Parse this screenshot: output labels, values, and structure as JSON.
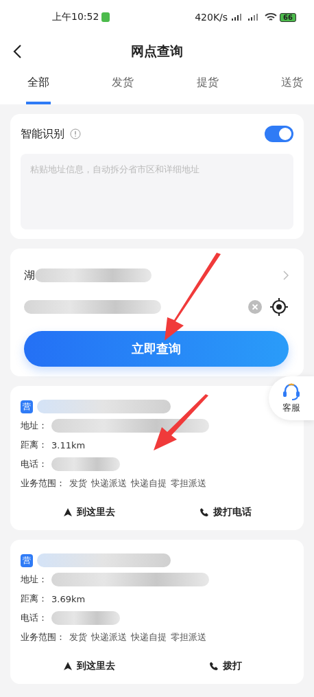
{
  "status_bar": {
    "time": "上午10:52",
    "net_speed": "420K/s",
    "battery": "66"
  },
  "header": {
    "title": "网点查询"
  },
  "tabs": [
    {
      "label": "全部",
      "selected": true
    },
    {
      "label": "发货",
      "selected": false
    },
    {
      "label": "提货",
      "selected": false
    },
    {
      "label": "送货",
      "selected": false
    }
  ],
  "smart_recognition": {
    "label": "智能识别",
    "on": true,
    "placeholder": "粘贴地址信息，自动拆分省市区和详细地址"
  },
  "address": {
    "region": "湖",
    "query_button": "立即查询"
  },
  "service_button": {
    "label": "客服"
  },
  "results": [
    {
      "badge": "营",
      "address_label": "地址：",
      "distance_label": "距离：",
      "distance": "3.11km",
      "phone_label": "电话：",
      "scope_label": "业务范围：",
      "services": [
        "发货",
        "快递派送",
        "快递自提",
        "零担派送"
      ],
      "actions": [
        "到这里去",
        "拨打电话"
      ]
    },
    {
      "badge": "营",
      "address_label": "地址：",
      "distance_label": "距离：",
      "distance": "3.69km",
      "phone_label": "电话：",
      "scope_label": "业务范围：",
      "services": [
        "发货",
        "快递派送",
        "快递自提",
        "零担派送"
      ],
      "actions": [
        "到这里去",
        "拨打"
      ]
    }
  ]
}
